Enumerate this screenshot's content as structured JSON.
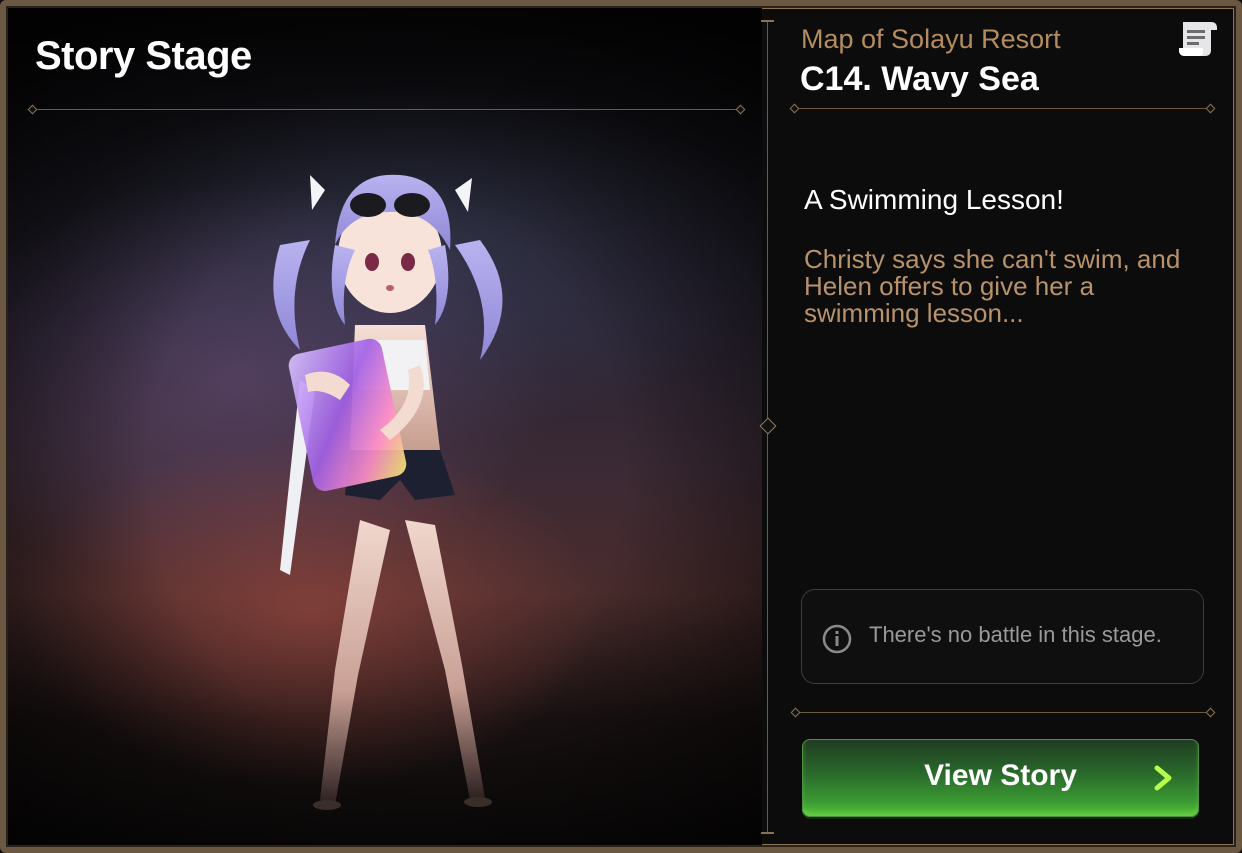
{
  "header": {
    "title": "Story Stage"
  },
  "stage": {
    "map_name": "Map of Solayu Resort",
    "stage_name": "C14. Wavy Sea"
  },
  "story": {
    "title": "A Swimming Lesson!",
    "description": "Christy says she can't swim, and Helen offers to give her a swimming lesson..."
  },
  "notice": {
    "text": "There's no battle in this stage.",
    "icon": "info-icon"
  },
  "actions": {
    "view_story_label": "View Story",
    "arrow_icon": "chevron-right-icon"
  },
  "icons": {
    "top_right": "scroll-icon"
  },
  "colors": {
    "accent_gold": "#b48d5f",
    "button_green": "#3a9a33",
    "frame": "#6b5842"
  }
}
